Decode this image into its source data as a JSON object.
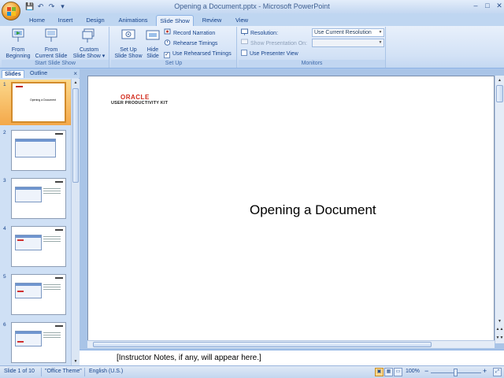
{
  "window": {
    "title": "Opening a Document.pptx - Microsoft PowerPoint",
    "min_label": "‒",
    "max_label": "□",
    "close_label": "✕"
  },
  "qat": {
    "save": "💾",
    "undo": "↶",
    "redo": "↷",
    "customize": "▾"
  },
  "ribbon_tabs": [
    {
      "label": "Home"
    },
    {
      "label": "Insert"
    },
    {
      "label": "Design"
    },
    {
      "label": "Animations"
    },
    {
      "label": "Slide Show",
      "active": true
    },
    {
      "label": "Review"
    },
    {
      "label": "View"
    }
  ],
  "ribbon": {
    "start": {
      "group_label": "Start Slide Show",
      "from_beginning": [
        "From",
        "Beginning"
      ],
      "from_current": [
        "From",
        "Current Slide"
      ],
      "custom": [
        "Custom",
        "Slide Show ▾"
      ]
    },
    "setup": {
      "group_label": "Set Up",
      "set_up": [
        "Set Up",
        "Slide Show"
      ],
      "hide": [
        "Hide",
        "Slide"
      ],
      "record_narration": "Record Narration",
      "rehearse_timings": "Rehearse Timings",
      "use_rehearsed": "Use Rehearsed Timings",
      "use_rehearsed_checked": true
    },
    "monitors": {
      "group_label": "Monitors",
      "resolution_label": "Resolution:",
      "resolution_value": "Use Current Resolution",
      "show_on_label": "Show Presentation On:",
      "show_on_value": "",
      "presenter_view": "Use Presenter View",
      "presenter_view_checked": false
    }
  },
  "panel": {
    "tabs": [
      {
        "label": "Slides",
        "active": true
      },
      {
        "label": "Outline"
      }
    ],
    "close": "×",
    "slides": [
      {
        "num": "1",
        "selected": true,
        "kind": "title",
        "title": "Opening a Document"
      },
      {
        "num": "2",
        "kind": "screen"
      },
      {
        "num": "3",
        "kind": "screen"
      },
      {
        "num": "4",
        "kind": "screen-hl"
      },
      {
        "num": "5",
        "kind": "screen-hl"
      },
      {
        "num": "6",
        "kind": "screen-hl"
      }
    ]
  },
  "slide": {
    "brand_top": "ORACLE",
    "brand_bottom": "USER PRODUCTIVITY KIT",
    "title": "Opening a Document"
  },
  "notes": {
    "text": "[Instructor Notes, if any, will appear here.]"
  },
  "status": {
    "slide_info": "Slide 1 of 10",
    "theme": "\"Office Theme\"",
    "language": "English (U.S.)",
    "zoom": "100%",
    "zoom_out": "−",
    "zoom_in": "+",
    "zoom_level": 0.5
  },
  "colors": {
    "accent": "#15428b",
    "oracle_red": "#d22c1e",
    "selected": "#f4a84a"
  }
}
